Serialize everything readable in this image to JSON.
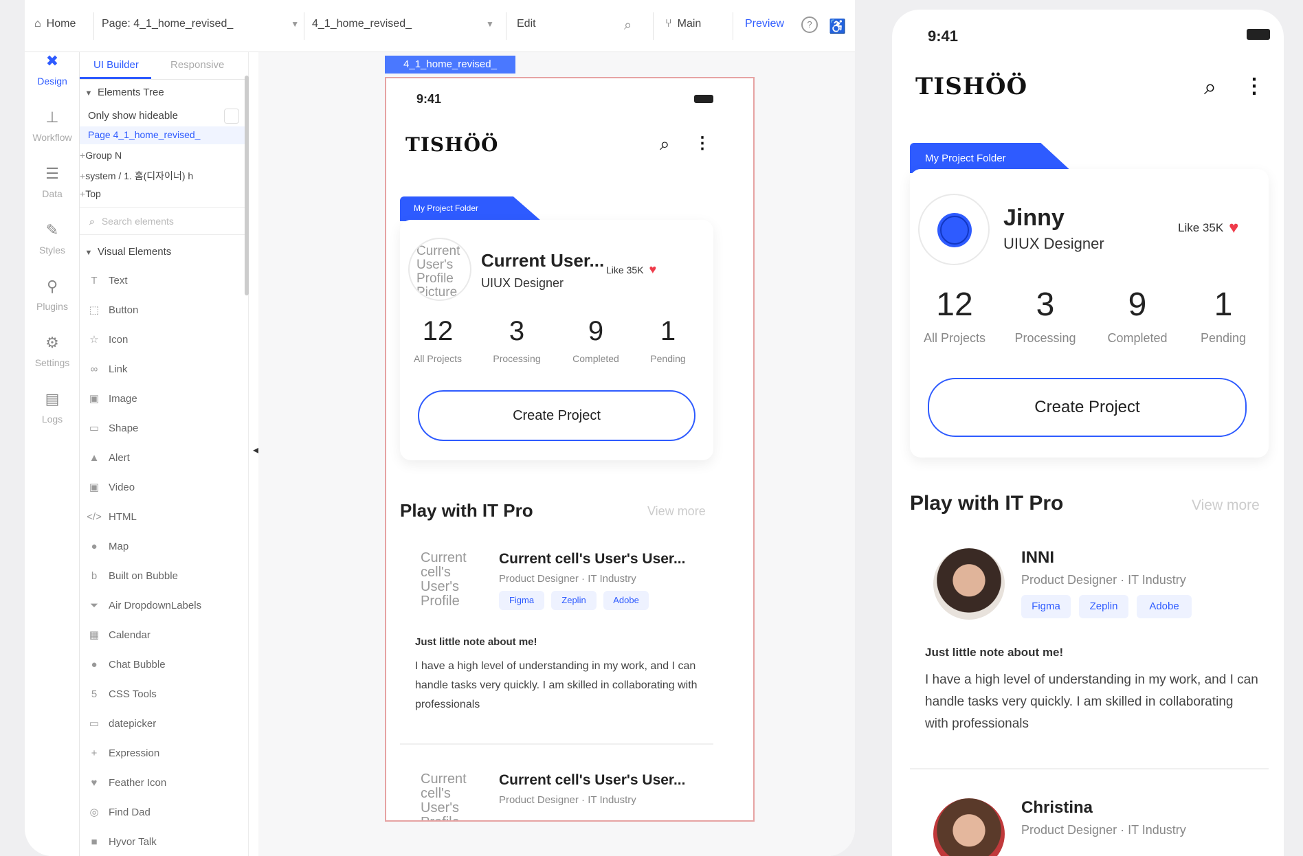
{
  "topbar": {
    "home": "Home",
    "page_label": "Page: 4_1_home_revised_",
    "page_select": "4_1_home_revised_",
    "edit": "Edit",
    "branch": "Main",
    "preview": "Preview"
  },
  "rail": [
    {
      "label": "Design",
      "icon": "design-icon"
    },
    {
      "label": "Workflow",
      "icon": "workflow-icon"
    },
    {
      "label": "Data",
      "icon": "database-icon"
    },
    {
      "label": "Styles",
      "icon": "brush-icon"
    },
    {
      "label": "Plugins",
      "icon": "plug-icon"
    },
    {
      "label": "Settings",
      "icon": "gear-icon"
    },
    {
      "label": "Logs",
      "icon": "document-icon"
    }
  ],
  "panel": {
    "tab_builder": "UI Builder",
    "tab_responsive": "Responsive",
    "elements_tree": "Elements Tree",
    "only_show_hideable": "Only show hideable",
    "page_node": "Page 4_1_home_revised_",
    "tree": [
      "Group N",
      "system / 1. 홈(디자이너) h",
      "Top"
    ],
    "search_placeholder": "Search elements",
    "visual_elements": "Visual Elements",
    "elements": [
      {
        "label": "Text",
        "icon": "text-icon"
      },
      {
        "label": "Button",
        "icon": "button-icon"
      },
      {
        "label": "Icon",
        "icon": "star-icon"
      },
      {
        "label": "Link",
        "icon": "link-icon"
      },
      {
        "label": "Image",
        "icon": "image-icon"
      },
      {
        "label": "Shape",
        "icon": "shape-icon"
      },
      {
        "label": "Alert",
        "icon": "alert-icon"
      },
      {
        "label": "Video",
        "icon": "video-icon"
      },
      {
        "label": "HTML",
        "icon": "code-icon"
      },
      {
        "label": "Map",
        "icon": "map-pin-icon"
      },
      {
        "label": "Built on Bubble",
        "icon": "bubble-icon"
      },
      {
        "label": "Air DropdownLabels",
        "icon": "dropdown-icon"
      },
      {
        "label": "Calendar",
        "icon": "calendar-icon"
      },
      {
        "label": "Chat Bubble",
        "icon": "chat-icon"
      },
      {
        "label": "CSS Tools",
        "icon": "css-icon"
      },
      {
        "label": "datepicker",
        "icon": "datepicker-icon"
      },
      {
        "label": "Expression",
        "icon": "plus-icon"
      },
      {
        "label": "Feather Icon",
        "icon": "heart-icon"
      },
      {
        "label": "Find Dad",
        "icon": "find-icon"
      },
      {
        "label": "Hyvor Talk",
        "icon": "talk-icon"
      }
    ]
  },
  "frame_tag": "4_1_home_revised_",
  "editor_phone": {
    "time": "9:41",
    "logo": "TISHÖÖ",
    "folder_tag": "My Project Folder",
    "avatar_placeholder": "Current User's Profile Picture",
    "user_name": "Current User...",
    "user_role": "UIUX Designer",
    "like": "Like 35K",
    "stats": [
      {
        "value": "12",
        "label": "All Projects"
      },
      {
        "value": "3",
        "label": "Processing"
      },
      {
        "value": "9",
        "label": "Completed"
      },
      {
        "value": "1",
        "label": "Pending"
      }
    ],
    "create_button": "Create Project",
    "section_title": "Play with IT Pro",
    "view_more": "View more",
    "pros": [
      {
        "avatar_placeholder": "Current cell's User's Profile",
        "name": "Current cell's User's User...",
        "sub": "Product Designer · IT Industry",
        "chips": [
          "Figma",
          "Zeplin",
          "Adobe"
        ],
        "note_title": "Just little note about me!",
        "note": "I have a high level of understanding in my work, and I can handle tasks very quickly. I am skilled in collaborating with professionals"
      },
      {
        "avatar_placeholder": "Current cell's User's Profile",
        "name": "Current cell's User's User...",
        "sub": "Product Designer · IT Industry"
      }
    ]
  },
  "preview_phone": {
    "time": "9:41",
    "logo": "TISHÖÖ",
    "folder_tag": "My Project Folder",
    "user_name": "Jinny",
    "user_role": "UIUX Designer",
    "like": "Like 35K",
    "stats": [
      {
        "value": "12",
        "label": "All Projects"
      },
      {
        "value": "3",
        "label": "Processing"
      },
      {
        "value": "9",
        "label": "Completed"
      },
      {
        "value": "1",
        "label": "Pending"
      }
    ],
    "create_button": "Create Project",
    "section_title": "Play with IT Pro",
    "view_more": "View more",
    "pros": [
      {
        "name": "INNI",
        "sub": "Product Designer · IT Industry",
        "chips": [
          "Figma",
          "Zeplin",
          "Adobe"
        ],
        "note_title": "Just little note about me!",
        "note": "I have a high level of understanding in my work, and I can handle tasks very quickly. I am skilled in collaborating with professionals"
      },
      {
        "name": "Christina",
        "sub": "Product Designer · IT Industry"
      }
    ]
  },
  "colors": {
    "accent": "#2e5bff",
    "heart": "#ef3b4a",
    "frame_border": "#e6a3a3"
  }
}
